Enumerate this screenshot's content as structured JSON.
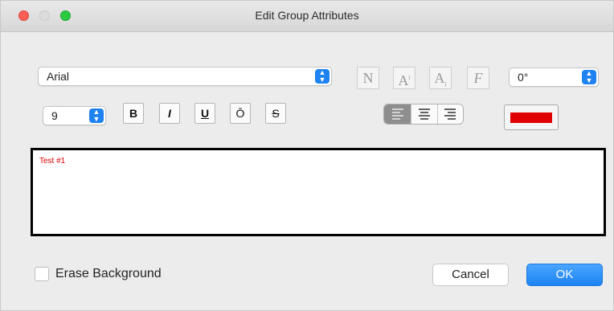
{
  "window": {
    "title": "Edit Group Attributes"
  },
  "font": {
    "family": "Arial",
    "size": "9",
    "rotation": "0°"
  },
  "format_buttons": [
    "B",
    "I",
    "U",
    "Ō",
    "S"
  ],
  "style_buttons": [
    "N",
    "A",
    "A",
    "F"
  ],
  "alignment": {
    "selected": "left",
    "options": [
      "left",
      "center",
      "right"
    ]
  },
  "text_color": "#e00000",
  "preview_text": "Test #1",
  "erase_background": {
    "label": "Erase Background",
    "checked": false
  },
  "buttons": {
    "cancel": "Cancel",
    "ok": "OK"
  }
}
